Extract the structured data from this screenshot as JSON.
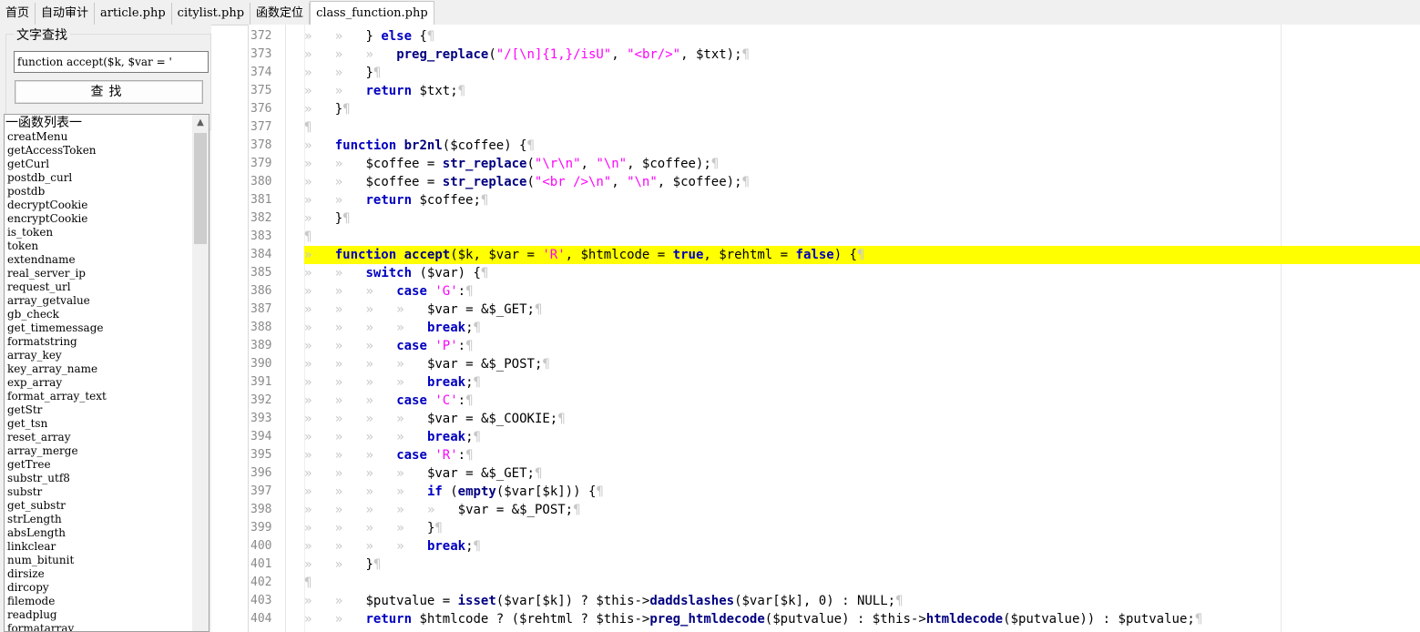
{
  "tabs": [
    {
      "label": "首页",
      "serif": false,
      "active": false
    },
    {
      "label": "自动审计",
      "serif": false,
      "active": false
    },
    {
      "label": "article.php",
      "serif": true,
      "active": false
    },
    {
      "label": "citylist.php",
      "serif": true,
      "active": false
    },
    {
      "label": "函数定位",
      "serif": false,
      "active": false
    },
    {
      "label": "class_function.php",
      "serif": true,
      "active": true
    }
  ],
  "search": {
    "legend": "文字查找",
    "value": "function accept($k, $var = '",
    "button": "查找"
  },
  "function_list": {
    "title": "一函数列表一",
    "items": [
      "creatMenu",
      "getAccessToken",
      "getCurl",
      "postdb_curl",
      "postdb",
      "decryptCookie",
      "encryptCookie",
      "is_token",
      "token",
      "extendname",
      "real_server_ip",
      "request_url",
      "array_getvalue",
      "gb_check",
      "get_timemessage",
      "formatstring",
      "array_key",
      "key_array_name",
      "exp_array",
      "format_array_text",
      "getStr",
      "get_tsn",
      "reset_array",
      "array_merge",
      "getTree",
      "substr_utf8",
      "substr",
      "get_substr",
      "strLength",
      "absLength",
      "linkclear",
      "num_bitunit",
      "dirsize",
      "dircopy",
      "filemode",
      "readplug",
      "formatarray"
    ]
  },
  "code": {
    "lines": [
      {
        "n": "372",
        "indent": 2,
        "tokens": [
          [
            "",
            "} "
          ],
          [
            "kw",
            "else"
          ],
          [
            "",
            " {"
          ]
        ]
      },
      {
        "n": "373",
        "indent": 3,
        "tokens": [
          [
            "fn",
            "preg_replace"
          ],
          [
            "",
            "("
          ],
          [
            "str",
            "\"/[\\n]{1,}/isU\""
          ],
          [
            "",
            ", "
          ],
          [
            "str",
            "\"<br/>\""
          ],
          [
            "",
            ", $txt);"
          ]
        ]
      },
      {
        "n": "374",
        "indent": 2,
        "tokens": [
          [
            "",
            "}"
          ]
        ]
      },
      {
        "n": "375",
        "indent": 2,
        "tokens": [
          [
            "kw",
            "return"
          ],
          [
            "",
            " $txt;"
          ]
        ]
      },
      {
        "n": "376",
        "indent": 1,
        "tokens": [
          [
            "",
            "}"
          ]
        ]
      },
      {
        "n": "377",
        "indent": 0,
        "tokens": []
      },
      {
        "n": "378",
        "indent": 1,
        "tokens": [
          [
            "kw",
            "function"
          ],
          [
            "",
            " "
          ],
          [
            "fn",
            "br2nl"
          ],
          [
            "",
            "($coffee) {"
          ]
        ]
      },
      {
        "n": "379",
        "indent": 2,
        "tokens": [
          [
            "",
            "$coffee = "
          ],
          [
            "fn",
            "str_replace"
          ],
          [
            "",
            "("
          ],
          [
            "str",
            "\"\\r\\n\""
          ],
          [
            "",
            ", "
          ],
          [
            "str",
            "\"\\n\""
          ],
          [
            "",
            ", $coffee);"
          ]
        ]
      },
      {
        "n": "380",
        "indent": 2,
        "tokens": [
          [
            "",
            "$coffee = "
          ],
          [
            "fn",
            "str_replace"
          ],
          [
            "",
            "("
          ],
          [
            "str",
            "\"<br />\\n\""
          ],
          [
            "",
            ", "
          ],
          [
            "str",
            "\"\\n\""
          ],
          [
            "",
            ", $coffee);"
          ]
        ]
      },
      {
        "n": "381",
        "indent": 2,
        "tokens": [
          [
            "kw",
            "return"
          ],
          [
            "",
            " $coffee;"
          ]
        ]
      },
      {
        "n": "382",
        "indent": 1,
        "tokens": [
          [
            "",
            "}"
          ]
        ]
      },
      {
        "n": "383",
        "indent": 0,
        "tokens": []
      },
      {
        "n": "384",
        "indent": 1,
        "highlight": true,
        "tokens": [
          [
            "kw",
            "function"
          ],
          [
            "",
            " "
          ],
          [
            "fn",
            "accept"
          ],
          [
            "",
            "($k, $var = "
          ],
          [
            "str",
            "'R'"
          ],
          [
            "",
            ", $htmlcode = "
          ],
          [
            "kw",
            "true"
          ],
          [
            "",
            ", $rehtml = "
          ],
          [
            "kw",
            "false"
          ],
          [
            "",
            ") {"
          ]
        ]
      },
      {
        "n": "385",
        "indent": 2,
        "tokens": [
          [
            "kw",
            "switch"
          ],
          [
            "",
            " ($var) {"
          ]
        ]
      },
      {
        "n": "386",
        "indent": 3,
        "tokens": [
          [
            "kw",
            "case"
          ],
          [
            "",
            " "
          ],
          [
            "str",
            "'G'"
          ],
          [
            "",
            ":"
          ]
        ]
      },
      {
        "n": "387",
        "indent": 4,
        "tokens": [
          [
            "",
            "$var = &$_GET;"
          ]
        ]
      },
      {
        "n": "388",
        "indent": 4,
        "tokens": [
          [
            "kw",
            "break"
          ],
          [
            "",
            ";"
          ]
        ]
      },
      {
        "n": "389",
        "indent": 3,
        "tokens": [
          [
            "kw",
            "case"
          ],
          [
            "",
            " "
          ],
          [
            "str",
            "'P'"
          ],
          [
            "",
            ":"
          ]
        ]
      },
      {
        "n": "390",
        "indent": 4,
        "tokens": [
          [
            "",
            "$var = &$_POST;"
          ]
        ]
      },
      {
        "n": "391",
        "indent": 4,
        "tokens": [
          [
            "kw",
            "break"
          ],
          [
            "",
            ";"
          ]
        ]
      },
      {
        "n": "392",
        "indent": 3,
        "tokens": [
          [
            "kw",
            "case"
          ],
          [
            "",
            " "
          ],
          [
            "str",
            "'C'"
          ],
          [
            "",
            ":"
          ]
        ]
      },
      {
        "n": "393",
        "indent": 4,
        "tokens": [
          [
            "",
            "$var = &$_COOKIE;"
          ]
        ]
      },
      {
        "n": "394",
        "indent": 4,
        "tokens": [
          [
            "kw",
            "break"
          ],
          [
            "",
            ";"
          ]
        ]
      },
      {
        "n": "395",
        "indent": 3,
        "tokens": [
          [
            "kw",
            "case"
          ],
          [
            "",
            " "
          ],
          [
            "str",
            "'R'"
          ],
          [
            "",
            ":"
          ]
        ]
      },
      {
        "n": "396",
        "indent": 4,
        "tokens": [
          [
            "",
            "$var = &$_GET;"
          ]
        ]
      },
      {
        "n": "397",
        "indent": 4,
        "tokens": [
          [
            "kw",
            "if"
          ],
          [
            "",
            " ("
          ],
          [
            "fn",
            "empty"
          ],
          [
            "",
            "($var[$k])) {"
          ]
        ]
      },
      {
        "n": "398",
        "indent": 5,
        "tokens": [
          [
            "",
            "$var = &$_POST;"
          ]
        ]
      },
      {
        "n": "399",
        "indent": 4,
        "tokens": [
          [
            "",
            "}"
          ]
        ]
      },
      {
        "n": "400",
        "indent": 4,
        "tokens": [
          [
            "kw",
            "break"
          ],
          [
            "",
            ";"
          ]
        ]
      },
      {
        "n": "401",
        "indent": 2,
        "tokens": [
          [
            "",
            "}"
          ]
        ]
      },
      {
        "n": "402",
        "indent": 0,
        "tokens": []
      },
      {
        "n": "403",
        "indent": 2,
        "tokens": [
          [
            "",
            "$putvalue = "
          ],
          [
            "fn",
            "isset"
          ],
          [
            "",
            "($var[$k]) ? $this->"
          ],
          [
            "fn",
            "daddslashes"
          ],
          [
            "",
            "($var[$k], 0) : NULL;"
          ]
        ]
      },
      {
        "n": "404",
        "indent": 2,
        "tokens": [
          [
            "kw",
            "return"
          ],
          [
            "",
            " $htmlcode ? ($rehtml ? $this->"
          ],
          [
            "fn",
            "preg_htmldecode"
          ],
          [
            "",
            "($putvalue) : $this->"
          ],
          [
            "fn",
            "htmldecode"
          ],
          [
            "",
            "($putvalue)) : $putvalue;"
          ]
        ]
      }
    ]
  },
  "colors": {
    "highlight": "#ffff00",
    "keyword": "#0000c0",
    "function": "#000080",
    "string": "#ff00ff",
    "whitespace_marker": "#c8c8c8"
  },
  "glyphs": {
    "tab_marker": "»",
    "eol_marker": "¶"
  }
}
